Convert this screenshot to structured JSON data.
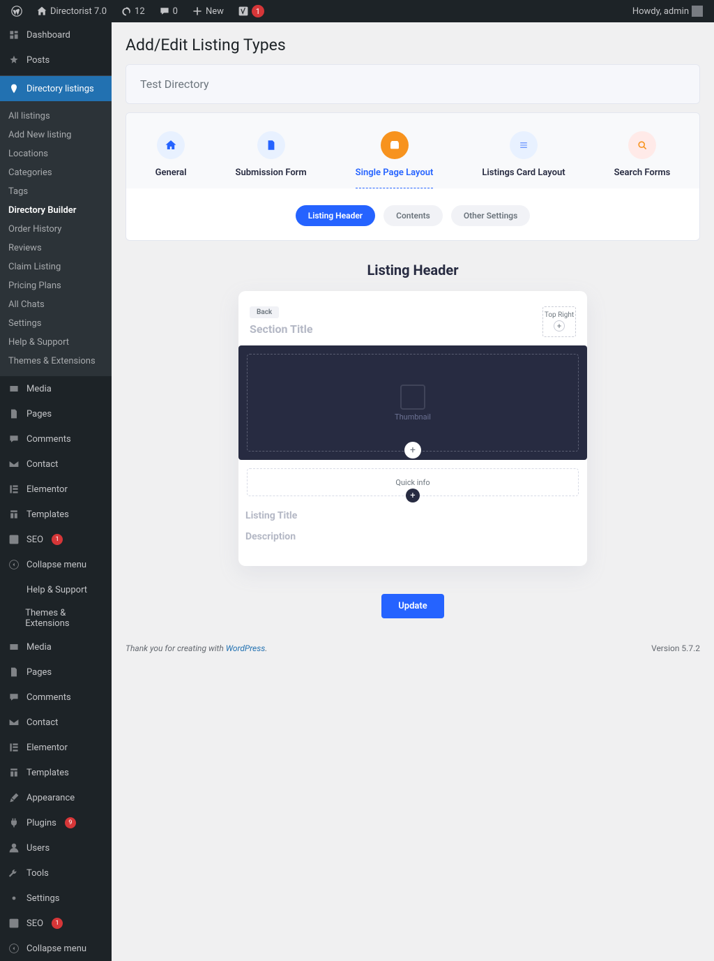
{
  "adminbar": {
    "site_name": "Directorist 7.0",
    "updates": "12",
    "comments": "0",
    "new": "New",
    "yoast_badge": "1",
    "howdy": "Howdy, admin"
  },
  "sidebar": {
    "items": [
      {
        "label": "Dashboard",
        "icon": "dashboard"
      },
      {
        "label": "Posts",
        "icon": "pin"
      },
      {
        "label": "Directory listings",
        "icon": "location",
        "current": true
      },
      {
        "label": "Media",
        "icon": "media"
      },
      {
        "label": "Pages",
        "icon": "page"
      },
      {
        "label": "Comments",
        "icon": "comment"
      },
      {
        "label": "Contact",
        "icon": "mail"
      },
      {
        "label": "Elementor",
        "icon": "elementor"
      },
      {
        "label": "Templates",
        "icon": "template"
      },
      {
        "label": "SEO",
        "icon": "yoast",
        "badge": "1"
      },
      {
        "label": "Collapse menu",
        "icon": "collapse"
      },
      {
        "label": "Help & Support"
      },
      {
        "label": "Themes & Extensions"
      },
      {
        "label": "Media",
        "icon": "media"
      },
      {
        "label": "Pages",
        "icon": "page"
      },
      {
        "label": "Comments",
        "icon": "comment"
      },
      {
        "label": "Contact",
        "icon": "mail"
      },
      {
        "label": "Elementor",
        "icon": "elementor"
      },
      {
        "label": "Templates",
        "icon": "template"
      },
      {
        "label": "Appearance",
        "icon": "brush"
      },
      {
        "label": "Plugins",
        "icon": "plugin",
        "badge": "9"
      },
      {
        "label": "Users",
        "icon": "user"
      },
      {
        "label": "Tools",
        "icon": "wrench"
      },
      {
        "label": "Settings",
        "icon": "gear"
      },
      {
        "label": "SEO",
        "icon": "yoast",
        "badge": "1"
      },
      {
        "label": "Collapse menu",
        "icon": "collapse"
      }
    ],
    "submenu": [
      "All listings",
      "Add New listing",
      "Locations",
      "Categories",
      "Tags",
      "Directory Builder",
      "Order History",
      "Reviews",
      "Claim Listing",
      "Pricing Plans",
      "All Chats",
      "Settings",
      "Help & Support",
      "Themes & Extensions"
    ],
    "submenu_current": "Directory Builder"
  },
  "page": {
    "title": "Add/Edit Listing Types",
    "directory_name": "Test Directory"
  },
  "tabs": [
    {
      "label": "General",
      "icon": "general"
    },
    {
      "label": "Submission Form",
      "icon": "submission"
    },
    {
      "label": "Single Page Layout",
      "icon": "single",
      "active": true
    },
    {
      "label": "Listings Card Layout",
      "icon": "cards"
    },
    {
      "label": "Search Forms",
      "icon": "search"
    }
  ],
  "subtabs": [
    {
      "label": "Listing Header",
      "active": true
    },
    {
      "label": "Contents"
    },
    {
      "label": "Other Settings"
    }
  ],
  "section": {
    "heading": "Listing Header"
  },
  "builder": {
    "back": "Back",
    "section_title_placeholder": "Section Title",
    "top_right": "Top Right",
    "thumbnail": "Thumbnail",
    "quick_info": "Quick info",
    "listing_title": "Listing Title",
    "description": "Description"
  },
  "actions": {
    "update": "Update"
  },
  "footer": {
    "thanks_prefix": "Thank you for creating with ",
    "wp": "WordPress",
    "version": "Version 5.7.2"
  }
}
